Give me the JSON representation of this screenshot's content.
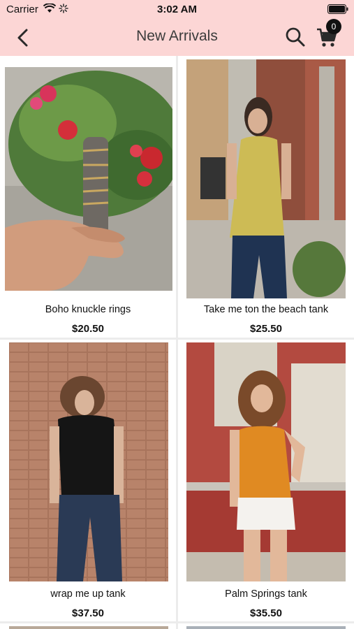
{
  "status_bar": {
    "carrier": "Carrier",
    "time": "3:02 AM"
  },
  "nav": {
    "title": "New Arrivals",
    "back_icon": "chevron-left-icon",
    "search_icon": "search-icon",
    "cart_icon": "shopping-cart-icon",
    "cart_count": "0"
  },
  "colors": {
    "header_bg": "#fcd6d5",
    "badge_bg": "#111111",
    "card_bg": "#ffffff",
    "grid_bg": "#ececec"
  },
  "products": [
    {
      "name": "Boho knuckle rings",
      "price": "$20.50"
    },
    {
      "name": "Take me ton the beach tank",
      "price": "$25.50"
    },
    {
      "name": "wrap me up tank",
      "price": "$37.50"
    },
    {
      "name": "Palm Springs tank",
      "price": "$35.50"
    }
  ]
}
